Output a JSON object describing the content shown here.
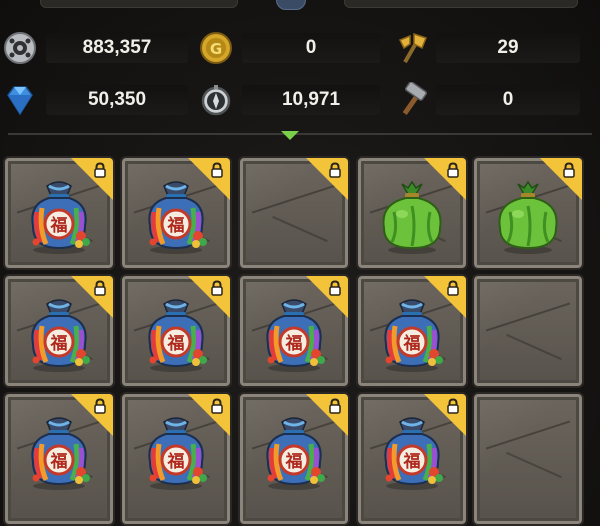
{
  "resources": {
    "row1": [
      {
        "icon": "silver-coin-icon",
        "value": "883,357"
      },
      {
        "icon": "gold-coin-icon",
        "value": "0"
      },
      {
        "icon": "golden-axe-icon",
        "value": "29"
      }
    ],
    "row2": [
      {
        "icon": "diamond-icon",
        "value": "50,350"
      },
      {
        "icon": "compass-icon",
        "value": "10,971"
      },
      {
        "icon": "hammer-icon",
        "value": "0"
      }
    ]
  },
  "colors": {
    "lock_badge": "#f3c43a",
    "divider_arrow": "#7bd04a",
    "slot_stone": "#605a52"
  },
  "inventory": {
    "rows": [
      [
        {
          "item": "lucky-bag-icon",
          "locked": true
        },
        {
          "item": "lucky-bag-icon",
          "locked": true
        },
        {
          "item": "",
          "locked": true
        },
        {
          "item": "green-bag-icon",
          "locked": true
        },
        {
          "item": "green-bag-icon",
          "locked": true
        }
      ],
      [
        {
          "item": "lucky-bag-icon",
          "locked": true
        },
        {
          "item": "lucky-bag-icon",
          "locked": true
        },
        {
          "item": "lucky-bag-icon",
          "locked": true
        },
        {
          "item": "lucky-bag-icon",
          "locked": true
        },
        {
          "item": "",
          "locked": false
        }
      ],
      [
        {
          "item": "lucky-bag-icon",
          "locked": true
        },
        {
          "item": "lucky-bag-icon",
          "locked": true
        },
        {
          "item": "lucky-bag-icon",
          "locked": true
        },
        {
          "item": "lucky-bag-icon",
          "locked": true
        },
        {
          "item": "",
          "locked": false
        }
      ]
    ],
    "bag_character": "福"
  }
}
